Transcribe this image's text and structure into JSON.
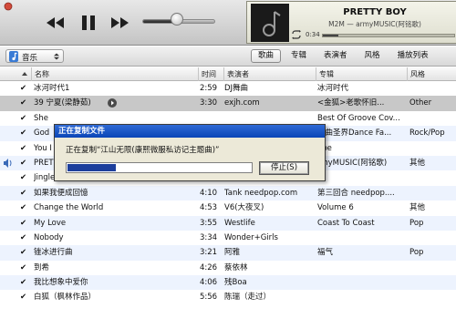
{
  "player": {
    "volume_level": 0.48,
    "now_playing": {
      "title": "PRETTY BOY",
      "subtitle": "M2M — armyMUSIC(阿铭歌)",
      "elapsed": "0:34",
      "progress": 0.12
    }
  },
  "library_select": {
    "label": "音乐"
  },
  "view_tabs": [
    "歌曲",
    "专辑",
    "表演者",
    "风格",
    "播放列表"
  ],
  "active_tab_index": 0,
  "columns": {
    "name": "名称",
    "time": "时间",
    "artist": "表演者",
    "album": "专辑",
    "genre": "风格"
  },
  "tracks": [
    {
      "check": "✔",
      "name": "冰河时代1",
      "time": "2:59",
      "artist": "DJ舞曲",
      "album": "冰河时代",
      "genre": ""
    },
    {
      "check": "✔",
      "name": "39 宁夏(梁静茹)",
      "time": "3:30",
      "artist": "exjh.com",
      "album": "<金狐>老歌怀旧...",
      "genre": "Other"
    },
    {
      "check": "✔",
      "name": "She",
      "time": "",
      "artist": "",
      "album": "Best Of Groove Cov...",
      "genre": ""
    },
    {
      "check": "✔",
      "name": "God",
      "time": "",
      "artist": "",
      "album": "舞曲圣界Dance Fa...",
      "genre": "Rock/Pop"
    },
    {
      "check": "✔",
      "name": "You I",
      "time": "",
      "artist": "",
      "album": "ope",
      "genre": ""
    },
    {
      "check": "✔",
      "name": "PRET",
      "time": "",
      "artist": "",
      "album": "rmyMUSIC(阿铭歌)",
      "genre": "其他"
    },
    {
      "check": "✔",
      "name": "Jingle Bell (Club Mix)",
      "time": "4:41",
      "artist": "Sound Up!",
      "album": "",
      "genre": ""
    },
    {
      "check": "✔",
      "name": "如果我便成回憶",
      "time": "4:10",
      "artist": "Tank needpop.com",
      "album": "第三回合 needpop....",
      "genre": ""
    },
    {
      "check": "✔",
      "name": "Change the World",
      "time": "4:53",
      "artist": "V6(大夜叉)",
      "album": "Volume 6",
      "genre": "其他"
    },
    {
      "check": "✔",
      "name": "My Love",
      "time": "3:55",
      "artist": "Westlife",
      "album": "Coast To Coast",
      "genre": "Pop"
    },
    {
      "check": "✔",
      "name": "Nobody",
      "time": "3:34",
      "artist": "Wonder+Girls",
      "album": "",
      "genre": ""
    },
    {
      "check": "✔",
      "name": "锉冰进行曲",
      "time": "3:21",
      "artist": "阿雅",
      "album": "福气",
      "genre": "Pop"
    },
    {
      "check": "✔",
      "name": "到希",
      "time": "4:26",
      "artist": "蔡依林",
      "album": "",
      "genre": ""
    },
    {
      "check": "✔",
      "name": "我比想象中爱你",
      "time": "4:06",
      "artist": "残Boa",
      "album": "",
      "genre": ""
    },
    {
      "check": "✔",
      "name": "白狐（枫林作品）",
      "time": "5:56",
      "artist": "陈瑞（走过）",
      "album": "",
      "genre": ""
    }
  ],
  "playing_index": 5,
  "selected_index": 1,
  "dialog": {
    "title": "正在复制文件",
    "message": "正在复制“江山无限(康熙微服私访记主题曲)”",
    "progress": 0.26,
    "stop_label": "停止(S)"
  }
}
